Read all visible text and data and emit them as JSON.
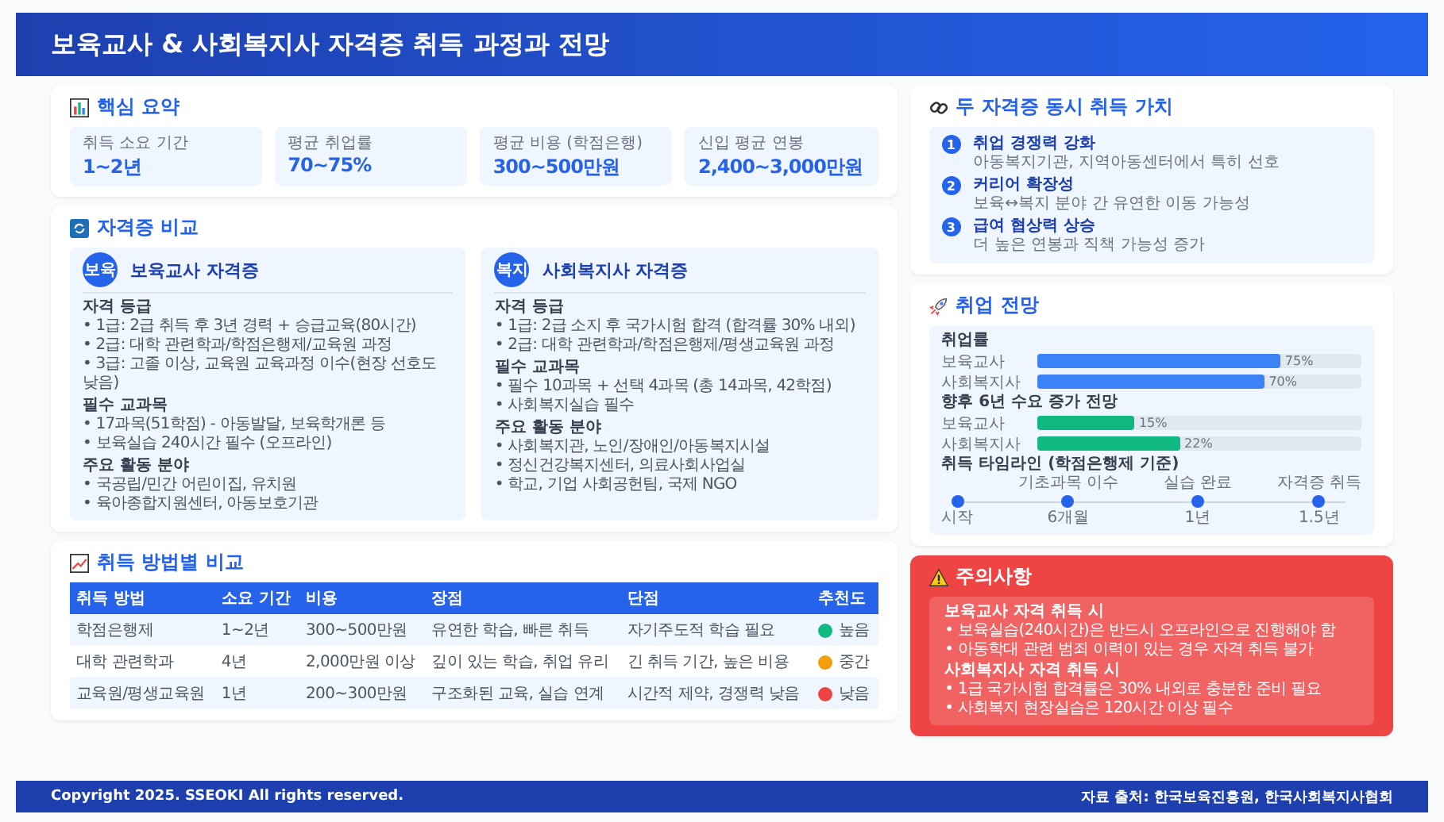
{
  "header": {
    "title": "보육교사 & 사회복지사 자격증 취득 과정과 전망"
  },
  "summary": {
    "title": "핵심 요약",
    "stats": [
      {
        "label": "취득 소요 기간",
        "value": "1~2년"
      },
      {
        "label": "평균 취업률",
        "value": "70~75%"
      },
      {
        "label": "평균 비용 (학점은행)",
        "value": "300~500만원"
      },
      {
        "label": "신입 평균 연봉",
        "value": "2,400~3,000만원"
      }
    ]
  },
  "comparison": {
    "title": "자격증 비교",
    "certs": [
      {
        "badge": "보육",
        "name": "보육교사 자격증",
        "sections": [
          {
            "heading": "자격 등급",
            "items": [
              "• 1급: 2급 취득 후 3년 경력 + 승급교육(80시간)",
              "• 2급: 대학 관련학과/학점은행제/교육원 과정",
              "• 3급: 고졸 이상, 교육원 교육과정 이수(현장 선호도 낮음)"
            ]
          },
          {
            "heading": "필수 교과목",
            "items": [
              "• 17과목(51학점) - 아동발달, 보육학개론 등",
              "• 보육실습 240시간 필수 (오프라인)"
            ]
          },
          {
            "heading": "주요 활동 분야",
            "items": [
              "• 국공립/민간 어린이집, 유치원",
              "• 육아종합지원센터, 아동보호기관"
            ]
          }
        ]
      },
      {
        "badge": "복지",
        "name": "사회복지사 자격증",
        "sections": [
          {
            "heading": "자격 등급",
            "items": [
              "• 1급: 2급 소지 후 국가시험 합격 (합격률 30% 내외)",
              "• 2급: 대학 관련학과/학점은행제/평생교육원 과정"
            ]
          },
          {
            "heading": "필수 교과목",
            "items": [
              "• 필수 10과목 + 선택 4과목 (총 14과목, 42학점)",
              "• 사회복지실습 필수"
            ]
          },
          {
            "heading": "주요 활동 분야",
            "items": [
              "• 사회복지관, 노인/장애인/아동복지시설",
              "• 정신건강복지센터, 의료사회사업실",
              "• 학교, 기업 사회공헌팀, 국제 NGO"
            ]
          }
        ]
      }
    ]
  },
  "methods": {
    "title": "취득 방법별 비교",
    "columns": [
      "취득 방법",
      "소요 기간",
      "비용",
      "장점",
      "단점",
      "추천도"
    ],
    "rows": [
      {
        "cells": [
          "학점은행제",
          "1~2년",
          "300~500만원",
          "유연한 학습, 빠른 취득",
          "자기주도적 학습 필요"
        ],
        "recommend": "높음",
        "color": "#10b981"
      },
      {
        "cells": [
          "대학 관련학과",
          "4년",
          "2,000만원 이상",
          "깊이 있는 학습, 취업 유리",
          "긴 취득 기간, 높은 비용"
        ],
        "recommend": "중간",
        "color": "#f59e0b"
      },
      {
        "cells": [
          "교육원/평생교육원",
          "1년",
          "200~300만원",
          "구조화된 교육, 실습 연계",
          "시간적 제약, 경쟁력 낮음"
        ],
        "recommend": "낮음",
        "color": "#ef4444"
      }
    ]
  },
  "value": {
    "title": "두 자격증 동시 취득 가치",
    "items": [
      {
        "number": "1",
        "title": "취업 경쟁력 강화",
        "desc": "아동복지기관, 지역아동센터에서 특히 선호"
      },
      {
        "number": "2",
        "title": "커리어 확장성",
        "desc": "보육↔복지 분야 간 유연한 이동 가능성"
      },
      {
        "number": "3",
        "title": "급여 협상력 상승",
        "desc": "더 높은 연봉과 직책 가능성 증가"
      }
    ]
  },
  "outlook": {
    "title": "취업 전망",
    "groups": [
      {
        "title": "취업률",
        "color": "#3b82f6",
        "bars": [
          {
            "label": "보육교사",
            "level": 0.75,
            "reading": "75%"
          },
          {
            "label": "사회복지사",
            "level": 0.7,
            "reading": "70%"
          }
        ]
      },
      {
        "title": "향후 6년 수요 증가 전망",
        "color": "#10b981",
        "bars": [
          {
            "label": "보육교사",
            "level": 0.3,
            "reading": "15%"
          },
          {
            "label": "사회복지사",
            "level": 0.44,
            "reading": "22%"
          }
        ]
      }
    ],
    "timeline": {
      "title": "취득 타임라인 (학점은행제 기준)",
      "steps": [
        {
          "bottom": "시작"
        },
        {
          "top": "기초과목 이수",
          "bottom": "6개월"
        },
        {
          "top": "실습 완료",
          "bottom": "1년"
        },
        {
          "top": "자격증 취득",
          "bottom": "1.5년"
        }
      ]
    }
  },
  "caution": {
    "title": "주의사항",
    "groups": [
      {
        "heading": "보육교사 자격 취득 시",
        "items": [
          "• 보육실습(240시간)은 반드시 오프라인으로 진행해야 함",
          "• 아동학대 관련 범죄 이력이 있는 경우 자격 취득 불가"
        ]
      },
      {
        "heading": "사회복지사 자격 취득 시",
        "items": [
          "• 1급 국가시험 합격률은 30% 내외로 충분한 준비 필요",
          "• 사회복지 현장실습은 120시간 이상 필수"
        ]
      }
    ]
  },
  "footer": {
    "copyright": "Copyright 2025. SSEOKI All rights reserved.",
    "source": "자료 출처: 한국보육진흥원, 한국사회복지사협회"
  }
}
